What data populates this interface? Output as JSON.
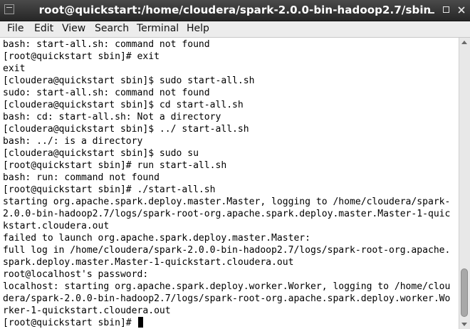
{
  "window": {
    "title": "root@quickstart:/home/cloudera/spark-2.0.0-bin-hadoop2.7/sbin",
    "titlebar_color": "#333333"
  },
  "menubar": {
    "items": [
      "File",
      "Edit",
      "View",
      "Search",
      "Terminal",
      "Help"
    ]
  },
  "terminal": {
    "background": "#ffffff",
    "foreground": "#000000",
    "lines": [
      "bash: start-all.sh: command not found",
      "[root@quickstart sbin]# exit",
      "exit",
      "[cloudera@quickstart sbin]$ sudo start-all.sh",
      "sudo: start-all.sh: command not found",
      "[cloudera@quickstart sbin]$ cd start-all.sh",
      "bash: cd: start-all.sh: Not a directory",
      "[cloudera@quickstart sbin]$ ../ start-all.sh",
      "bash: ../: is a directory",
      "[cloudera@quickstart sbin]$ sudo su",
      "[root@quickstart sbin]# run start-all.sh",
      "bash: run: command not found",
      "[root@quickstart sbin]# ./start-all.sh",
      "starting org.apache.spark.deploy.master.Master, logging to /home/cloudera/spark-",
      "2.0.0-bin-hadoop2.7/logs/spark-root-org.apache.spark.deploy.master.Master-1-quic",
      "kstart.cloudera.out",
      "failed to launch org.apache.spark.deploy.master.Master:",
      "full log in /home/cloudera/spark-2.0.0-bin-hadoop2.7/logs/spark-root-org.apache.",
      "spark.deploy.master.Master-1-quickstart.cloudera.out",
      "root@localhost's password:",
      "localhost: starting org.apache.spark.deploy.worker.Worker, logging to /home/clou",
      "dera/spark-2.0.0-bin-hadoop2.7/logs/spark-root-org.apache.spark.deploy.worker.Wo",
      "rker-1-quickstart.cloudera.out"
    ],
    "prompt": "[root@quickstart sbin]# "
  }
}
